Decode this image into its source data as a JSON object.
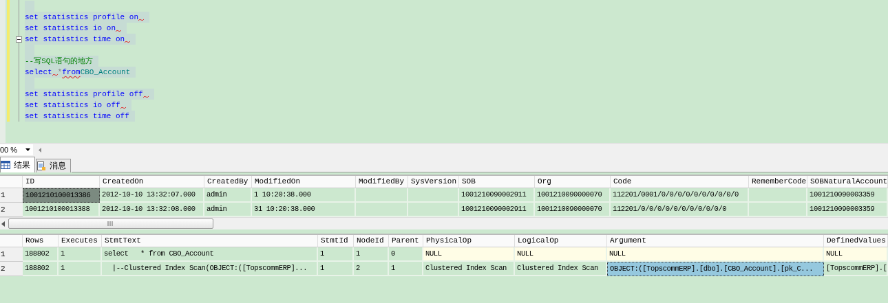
{
  "editor": {
    "lines": [
      {
        "kind": "blank"
      },
      {
        "kind": "code",
        "fold_box": false,
        "tokens": [
          {
            "text": "set statistics profile on",
            "kind": "keyword",
            "squiggle_after": true,
            "squiggle_under": false
          }
        ]
      },
      {
        "kind": "code",
        "fold_box": false,
        "tokens": [
          {
            "text": "set statistics io on",
            "kind": "keyword",
            "squiggle_after": true,
            "squiggle_under": false
          }
        ]
      },
      {
        "kind": "code",
        "fold_box": true,
        "tokens": [
          {
            "text": "set statistics time on",
            "kind": "keyword",
            "squiggle_after": true,
            "squiggle_under": false
          }
        ]
      },
      {
        "kind": "blank"
      },
      {
        "kind": "code",
        "fold_box": false,
        "tokens": [
          {
            "text": "--写SQL语句的地方",
            "kind": "comment",
            "squiggle_after": false,
            "squiggle_under": false
          }
        ]
      },
      {
        "kind": "code",
        "fold_box": false,
        "tokens": [
          {
            "text": "select",
            "kind": "keyword",
            "squiggle_after": true,
            "squiggle_under": false
          },
          {
            "text": "*",
            "kind": "operator",
            "squiggle_after": false,
            "squiggle_under": false
          },
          {
            "text": "from",
            "kind": "keyword",
            "squiggle_after": false,
            "squiggle_under": true
          },
          {
            "text": "CBO_Account",
            "kind": "identifier",
            "squiggle_after": false,
            "squiggle_under": false
          }
        ]
      },
      {
        "kind": "blank"
      },
      {
        "kind": "code",
        "fold_box": false,
        "tokens": [
          {
            "text": "set statistics profile off",
            "kind": "keyword",
            "squiggle_after": true,
            "squiggle_under": false
          }
        ]
      },
      {
        "kind": "code",
        "fold_box": false,
        "tokens": [
          {
            "text": "set statistics io off",
            "kind": "keyword",
            "squiggle_after": true,
            "squiggle_under": false
          }
        ]
      },
      {
        "kind": "code",
        "fold_box": false,
        "tokens": [
          {
            "text": "set statistics time off",
            "kind": "keyword",
            "squiggle_after": false,
            "squiggle_under": false
          }
        ]
      }
    ]
  },
  "zoom": {
    "value": "00 %"
  },
  "tabs": [
    {
      "label": "结果",
      "selected": true
    },
    {
      "label": "消息",
      "selected": false
    }
  ],
  "grids": [
    {
      "columns": [
        "ID",
        "CreatedOn",
        "CreatedBy",
        "ModifiedOn",
        "ModifiedBy",
        "SysVersion",
        "SOB",
        "Org",
        "Code",
        "RememberCode",
        "SOBNaturalAccount"
      ],
      "rows": [
        {
          "number": "1",
          "cells": [
            {
              "text": "1001210100013386",
              "selected": true,
              "is_null": false
            },
            {
              "text": "2012-10-10 13:32:07.000",
              "selected": false,
              "is_null": false
            },
            {
              "text": "admin",
              "selected": false,
              "is_null": false
            },
            {
              "text": "1 10:20:38.000",
              "selected": false,
              "is_null": false
            },
            {
              "selected": false,
              "is_null": false
            },
            {
              "selected": false,
              "is_null": false
            },
            {
              "text": "1001210090002911",
              "selected": false,
              "is_null": false
            },
            {
              "text": "1001210090000070",
              "selected": false,
              "is_null": false
            },
            {
              "text": "112201/0001/0/0/0/0/0/0/0/0/0/0",
              "selected": false,
              "is_null": false
            },
            {
              "selected": false,
              "is_null": false
            },
            {
              "text": "1001210090003359",
              "selected": false,
              "is_null": false
            }
          ]
        },
        {
          "number": "2",
          "cells": [
            {
              "text": "1001210100013388",
              "selected": false,
              "is_null": false
            },
            {
              "text": "2012-10-10 13:32:08.000",
              "selected": false,
              "is_null": false
            },
            {
              "text": "admin",
              "selected": false,
              "is_null": false
            },
            {
              "text": "31 10:20:38.000",
              "selected": false,
              "is_null": false
            },
            {
              "selected": false,
              "is_null": false
            },
            {
              "selected": false,
              "is_null": false
            },
            {
              "text": "1001210090002911",
              "selected": false,
              "is_null": false
            },
            {
              "text": "1001210090000070",
              "selected": false,
              "is_null": false
            },
            {
              "text": "112201/0/0/0/0/0/0/0/0/0/0/0",
              "selected": false,
              "is_null": false
            },
            {
              "selected": false,
              "is_null": false
            },
            {
              "text": "1001210090003359",
              "selected": false,
              "is_null": false
            }
          ]
        }
      ],
      "scrollbar": true
    },
    {
      "columns": [
        "Rows",
        "Executes",
        "StmtText",
        "StmtId",
        "NodeId",
        "Parent",
        "PhysicalOp",
        "LogicalOp",
        "Argument",
        "DefinedValues"
      ],
      "rows": [
        {
          "number": "1",
          "cells": [
            {
              "text": "188802",
              "selected": false,
              "is_null": false
            },
            {
              "text": "1",
              "selected": false,
              "is_null": false
            },
            {
              "text": "select   * from CBO_Account",
              "selected": false,
              "is_null": false
            },
            {
              "text": "1",
              "selected": false,
              "is_null": false
            },
            {
              "text": "1",
              "selected": false,
              "is_null": false
            },
            {
              "text": "0",
              "selected": false,
              "is_null": false
            },
            {
              "text": "NULL",
              "selected": false,
              "is_null": true
            },
            {
              "text": "NULL",
              "selected": false,
              "is_null": true
            },
            {
              "text": "NULL",
              "selected": false,
              "is_null": true
            },
            {
              "text": "NULL",
              "selected": false,
              "is_null": true
            }
          ]
        },
        {
          "number": "2",
          "cells": [
            {
              "text": "188802",
              "selected": false,
              "is_null": false
            },
            {
              "text": "1",
              "selected": false,
              "is_null": false
            },
            {
              "text": "  |--Clustered Index Scan(OBJECT:([TopscommERP]...",
              "selected": false,
              "is_null": false
            },
            {
              "text": "1",
              "selected": false,
              "is_null": false
            },
            {
              "text": "2",
              "selected": false,
              "is_null": false
            },
            {
              "text": "1",
              "selected": false,
              "is_null": false
            },
            {
              "text": "Clustered Index Scan",
              "selected": false,
              "is_null": false
            },
            {
              "text": "Clustered Index Scan",
              "selected": false,
              "is_null": false
            },
            {
              "text": "OBJECT:([TopscommERP].[dbo].[CBO_Account].[pk_C...",
              "selected": true,
              "is_null": false
            },
            {
              "text": "[TopscommERP].[",
              "selected": false,
              "is_null": false
            }
          ]
        }
      ],
      "scrollbar": false
    }
  ]
}
